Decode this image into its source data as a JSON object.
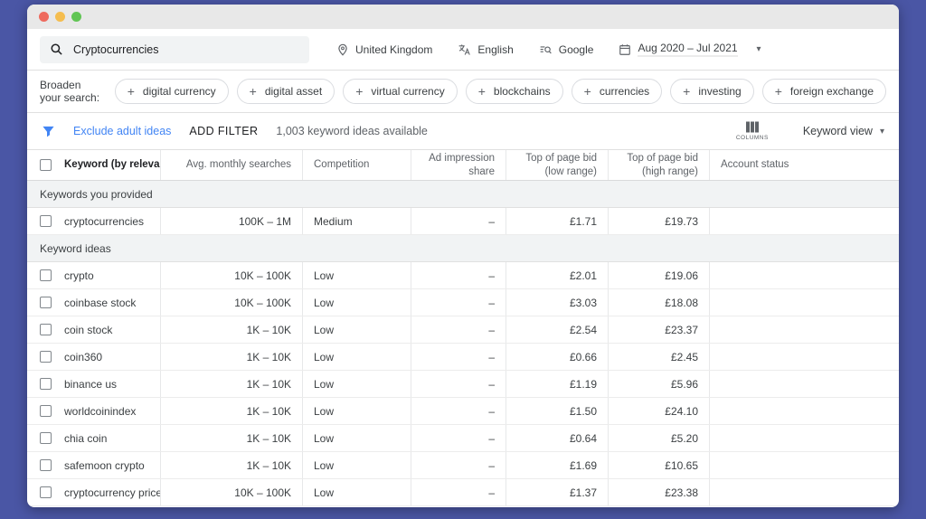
{
  "icons": {
    "plus": "+",
    "caret": "▾"
  },
  "colors": {
    "desktop-bg": "#4a56a5",
    "titlebar-bg": "#e8e8e8",
    "traffic-red": "#ee6a5e",
    "traffic-yellow": "#f5bd4f",
    "traffic-green": "#61c554",
    "accent-blue": "#4285f4",
    "text-primary": "#3c4043",
    "text-secondary": "#5f6368",
    "border": "#e0e0e0",
    "section-bg": "#f1f3f4",
    "searchbox-bg": "#f1f3f4"
  },
  "search": {
    "value": "Cryptocurrencies"
  },
  "toolbar": {
    "location": "United Kingdom",
    "language": "English",
    "network": "Google",
    "date_range": "Aug 2020 – Jul 2021"
  },
  "broaden": {
    "label": "Broaden your search:",
    "chips": [
      "digital currency",
      "digital asset",
      "virtual currency",
      "blockchains",
      "currencies",
      "investing",
      "foreign exchange"
    ]
  },
  "filterbar": {
    "exclude_adult": "Exclude adult ideas",
    "add_filter": "ADD FILTER",
    "ideas_count": "1,003 keyword ideas available",
    "columns_label": "COLUMNS",
    "view": "Keyword view"
  },
  "table": {
    "headers": [
      "Keyword (by relevance)",
      "Avg. monthly searches",
      "Competition",
      "Ad impression share",
      "Top of page bid (low range)",
      "Top of page bid (high range)",
      "Account status"
    ],
    "sections": [
      {
        "label": "Keywords you provided",
        "rows": [
          {
            "keyword": "cryptocurrencies",
            "searches": "100K – 1M",
            "competition": "Medium",
            "ad_share": "–",
            "bid_low": "£1.71",
            "bid_high": "£19.73",
            "account_status": ""
          }
        ]
      },
      {
        "label": "Keyword ideas",
        "rows": [
          {
            "keyword": "crypto",
            "searches": "10K – 100K",
            "competition": "Low",
            "ad_share": "–",
            "bid_low": "£2.01",
            "bid_high": "£19.06",
            "account_status": ""
          },
          {
            "keyword": "coinbase stock",
            "searches": "10K – 100K",
            "competition": "Low",
            "ad_share": "–",
            "bid_low": "£3.03",
            "bid_high": "£18.08",
            "account_status": ""
          },
          {
            "keyword": "coin stock",
            "searches": "1K – 10K",
            "competition": "Low",
            "ad_share": "–",
            "bid_low": "£2.54",
            "bid_high": "£23.37",
            "account_status": ""
          },
          {
            "keyword": "coin360",
            "searches": "1K – 10K",
            "competition": "Low",
            "ad_share": "–",
            "bid_low": "£0.66",
            "bid_high": "£2.45",
            "account_status": ""
          },
          {
            "keyword": "binance us",
            "searches": "1K – 10K",
            "competition": "Low",
            "ad_share": "–",
            "bid_low": "£1.19",
            "bid_high": "£5.96",
            "account_status": ""
          },
          {
            "keyword": "worldcoinindex",
            "searches": "1K – 10K",
            "competition": "Low",
            "ad_share": "–",
            "bid_low": "£1.50",
            "bid_high": "£24.10",
            "account_status": ""
          },
          {
            "keyword": "chia coin",
            "searches": "1K – 10K",
            "competition": "Low",
            "ad_share": "–",
            "bid_low": "£0.64",
            "bid_high": "£5.20",
            "account_status": ""
          },
          {
            "keyword": "safemoon crypto",
            "searches": "1K – 10K",
            "competition": "Low",
            "ad_share": "–",
            "bid_low": "£1.69",
            "bid_high": "£10.65",
            "account_status": ""
          },
          {
            "keyword": "cryptocurrency prices",
            "searches": "10K – 100K",
            "competition": "Low",
            "ad_share": "–",
            "bid_low": "£1.37",
            "bid_high": "£23.38",
            "account_status": ""
          }
        ]
      }
    ]
  }
}
